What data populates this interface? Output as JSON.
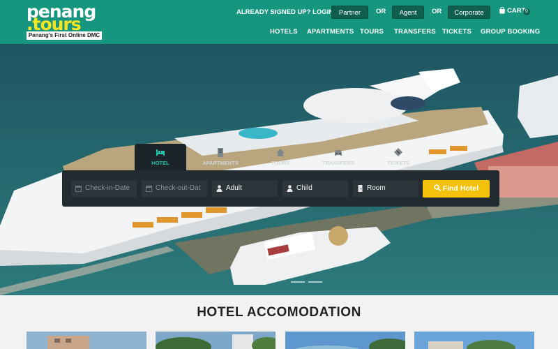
{
  "brand": {
    "name_part1": "penang",
    "name_part2": ".tours",
    "tagline": "Penang's First Online DMC"
  },
  "account": {
    "prompt": "ALREADY SIGNED UP? LOGIN AS",
    "or": "OR",
    "partner": "Partner",
    "agent": "Agent",
    "corporate": "Corporate",
    "cart_label": "CART",
    "cart_count": "0"
  },
  "nav": [
    "HOTELS",
    "APARTMENTS",
    "TOURS",
    "TRANSFERS",
    "TICKETS",
    "GROUP BOOKING"
  ],
  "search_tabs": [
    {
      "label": "HOTEL",
      "icon": "bed-icon",
      "active": true
    },
    {
      "label": "APARTMENTS",
      "icon": "building-icon",
      "active": false
    },
    {
      "label": "TOURS",
      "icon": "home-icon",
      "active": false
    },
    {
      "label": "TRANSFERS",
      "icon": "car-icon",
      "active": false
    },
    {
      "label": "TICKETS",
      "icon": "ticket-icon",
      "active": false
    }
  ],
  "search": {
    "checkin_placeholder": "Check-in-Date",
    "checkout_placeholder": "Check-out-Dat",
    "adult": "Adult",
    "child": "Child",
    "room": "Room",
    "find_button": "Find Hotel"
  },
  "section": {
    "title": "HOTEL ACCOMODATION"
  },
  "colors": {
    "header": "#16967f",
    "accent": "#1fc6aa",
    "button_yellow": "#f4c20d",
    "logo_yellow": "#f6e41f"
  }
}
